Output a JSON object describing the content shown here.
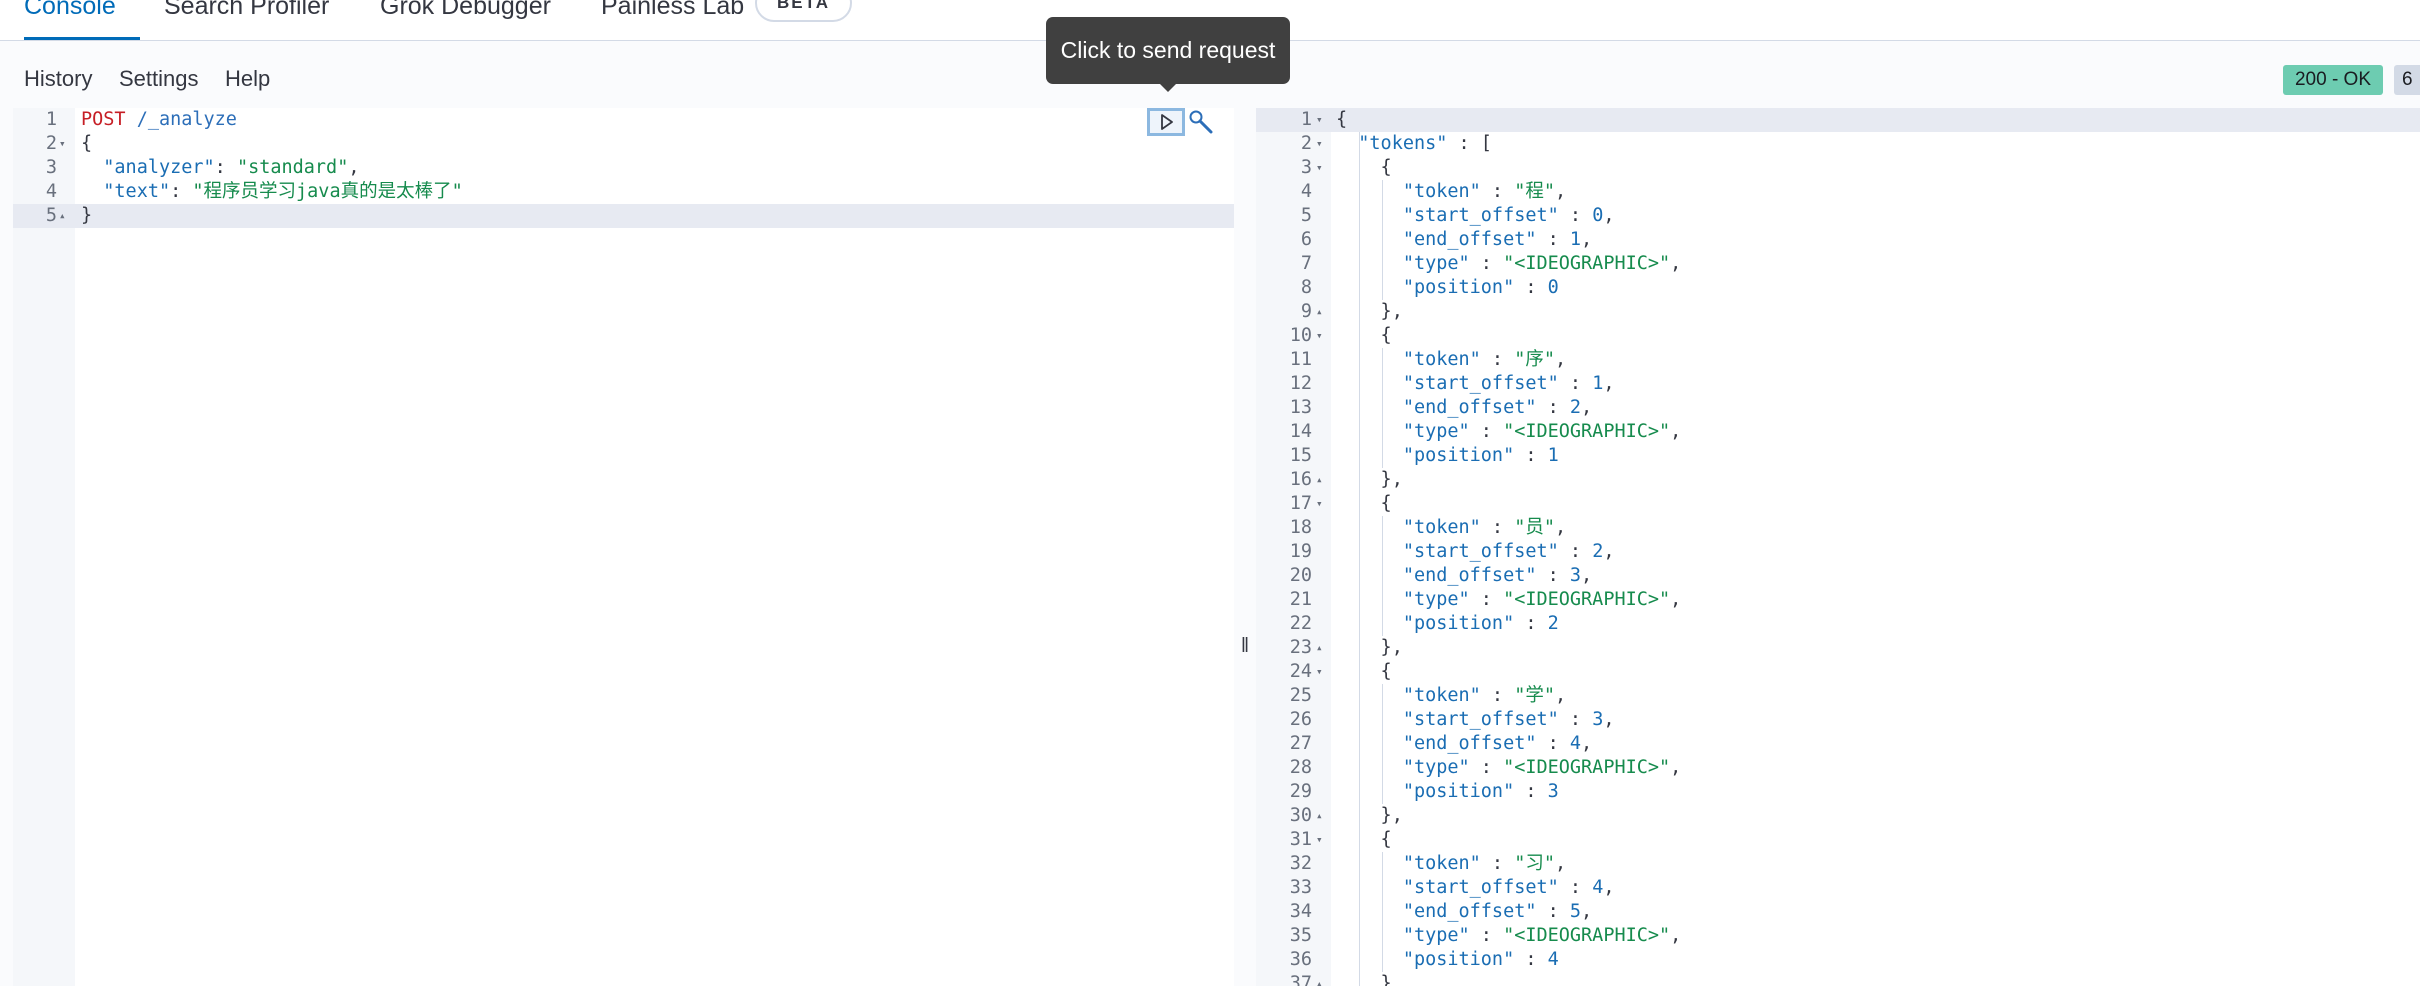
{
  "tabs": [
    {
      "label": "Console",
      "selected": true
    },
    {
      "label": "Search Profiler"
    },
    {
      "label": "Grok Debugger"
    },
    {
      "label": "Painless Lab",
      "badge": "BETA"
    }
  ],
  "menu": {
    "history": "History",
    "settings": "Settings",
    "help": "Help"
  },
  "status": {
    "code": "200 - OK",
    "time": "6"
  },
  "tooltip": "Click to send request",
  "request_lines": [
    {
      "n": "1",
      "parts": [
        [
          "method",
          "POST"
        ],
        [
          "punct",
          " "
        ],
        [
          "url",
          "/_analyze"
        ]
      ]
    },
    {
      "n": "2",
      "fold": "open",
      "parts": [
        [
          "punct",
          "{"
        ]
      ]
    },
    {
      "n": "3",
      "parts": [
        [
          "punct",
          "  "
        ],
        [
          "key",
          "\"analyzer\""
        ],
        [
          "punct",
          ": "
        ],
        [
          "str",
          "\"standard\""
        ],
        [
          "punct",
          ","
        ]
      ]
    },
    {
      "n": "4",
      "parts": [
        [
          "punct",
          "  "
        ],
        [
          "key",
          "\"text\""
        ],
        [
          "punct",
          ": "
        ],
        [
          "str",
          "\"程序员学习java真的是太棒了\""
        ]
      ]
    },
    {
      "n": "5",
      "fold": "close",
      "active": true,
      "parts": [
        [
          "punct",
          "}"
        ]
      ]
    }
  ],
  "response_lines": [
    {
      "n": "1",
      "fold": "open",
      "active": true,
      "parts": [
        [
          "punct",
          "{"
        ]
      ]
    },
    {
      "n": "2",
      "fold": "open",
      "parts": [
        [
          "punct",
          "  "
        ],
        [
          "key",
          "\"tokens\""
        ],
        [
          "punct",
          " : ["
        ]
      ]
    },
    {
      "n": "3",
      "fold": "open",
      "parts": [
        [
          "punct",
          "    {"
        ]
      ]
    },
    {
      "n": "4",
      "parts": [
        [
          "punct",
          "      "
        ],
        [
          "key",
          "\"token\""
        ],
        [
          "punct",
          " : "
        ],
        [
          "str",
          "\"程\""
        ],
        [
          "punct",
          ","
        ]
      ]
    },
    {
      "n": "5",
      "parts": [
        [
          "punct",
          "      "
        ],
        [
          "key",
          "\"start_offset\""
        ],
        [
          "punct",
          " : "
        ],
        [
          "num",
          "0"
        ],
        [
          "punct",
          ","
        ]
      ]
    },
    {
      "n": "6",
      "parts": [
        [
          "punct",
          "      "
        ],
        [
          "key",
          "\"end_offset\""
        ],
        [
          "punct",
          " : "
        ],
        [
          "num",
          "1"
        ],
        [
          "punct",
          ","
        ]
      ]
    },
    {
      "n": "7",
      "parts": [
        [
          "punct",
          "      "
        ],
        [
          "key",
          "\"type\""
        ],
        [
          "punct",
          " : "
        ],
        [
          "str",
          "\"<IDEOGRAPHIC>\""
        ],
        [
          "punct",
          ","
        ]
      ]
    },
    {
      "n": "8",
      "parts": [
        [
          "punct",
          "      "
        ],
        [
          "key",
          "\"position\""
        ],
        [
          "punct",
          " : "
        ],
        [
          "num",
          "0"
        ]
      ]
    },
    {
      "n": "9",
      "fold": "close",
      "parts": [
        [
          "punct",
          "    },"
        ]
      ]
    },
    {
      "n": "10",
      "fold": "open",
      "parts": [
        [
          "punct",
          "    {"
        ]
      ]
    },
    {
      "n": "11",
      "parts": [
        [
          "punct",
          "      "
        ],
        [
          "key",
          "\"token\""
        ],
        [
          "punct",
          " : "
        ],
        [
          "str",
          "\"序\""
        ],
        [
          "punct",
          ","
        ]
      ]
    },
    {
      "n": "12",
      "parts": [
        [
          "punct",
          "      "
        ],
        [
          "key",
          "\"start_offset\""
        ],
        [
          "punct",
          " : "
        ],
        [
          "num",
          "1"
        ],
        [
          "punct",
          ","
        ]
      ]
    },
    {
      "n": "13",
      "parts": [
        [
          "punct",
          "      "
        ],
        [
          "key",
          "\"end_offset\""
        ],
        [
          "punct",
          " : "
        ],
        [
          "num",
          "2"
        ],
        [
          "punct",
          ","
        ]
      ]
    },
    {
      "n": "14",
      "parts": [
        [
          "punct",
          "      "
        ],
        [
          "key",
          "\"type\""
        ],
        [
          "punct",
          " : "
        ],
        [
          "str",
          "\"<IDEOGRAPHIC>\""
        ],
        [
          "punct",
          ","
        ]
      ]
    },
    {
      "n": "15",
      "parts": [
        [
          "punct",
          "      "
        ],
        [
          "key",
          "\"position\""
        ],
        [
          "punct",
          " : "
        ],
        [
          "num",
          "1"
        ]
      ]
    },
    {
      "n": "16",
      "fold": "close",
      "parts": [
        [
          "punct",
          "    },"
        ]
      ]
    },
    {
      "n": "17",
      "fold": "open",
      "parts": [
        [
          "punct",
          "    {"
        ]
      ]
    },
    {
      "n": "18",
      "parts": [
        [
          "punct",
          "      "
        ],
        [
          "key",
          "\"token\""
        ],
        [
          "punct",
          " : "
        ],
        [
          "str",
          "\"员\""
        ],
        [
          "punct",
          ","
        ]
      ]
    },
    {
      "n": "19",
      "parts": [
        [
          "punct",
          "      "
        ],
        [
          "key",
          "\"start_offset\""
        ],
        [
          "punct",
          " : "
        ],
        [
          "num",
          "2"
        ],
        [
          "punct",
          ","
        ]
      ]
    },
    {
      "n": "20",
      "parts": [
        [
          "punct",
          "      "
        ],
        [
          "key",
          "\"end_offset\""
        ],
        [
          "punct",
          " : "
        ],
        [
          "num",
          "3"
        ],
        [
          "punct",
          ","
        ]
      ]
    },
    {
      "n": "21",
      "parts": [
        [
          "punct",
          "      "
        ],
        [
          "key",
          "\"type\""
        ],
        [
          "punct",
          " : "
        ],
        [
          "str",
          "\"<IDEOGRAPHIC>\""
        ],
        [
          "punct",
          ","
        ]
      ]
    },
    {
      "n": "22",
      "parts": [
        [
          "punct",
          "      "
        ],
        [
          "key",
          "\"position\""
        ],
        [
          "punct",
          " : "
        ],
        [
          "num",
          "2"
        ]
      ]
    },
    {
      "n": "23",
      "fold": "close",
      "parts": [
        [
          "punct",
          "    },"
        ]
      ]
    },
    {
      "n": "24",
      "fold": "open",
      "parts": [
        [
          "punct",
          "    {"
        ]
      ]
    },
    {
      "n": "25",
      "parts": [
        [
          "punct",
          "      "
        ],
        [
          "key",
          "\"token\""
        ],
        [
          "punct",
          " : "
        ],
        [
          "str",
          "\"学\""
        ],
        [
          "punct",
          ","
        ]
      ]
    },
    {
      "n": "26",
      "parts": [
        [
          "punct",
          "      "
        ],
        [
          "key",
          "\"start_offset\""
        ],
        [
          "punct",
          " : "
        ],
        [
          "num",
          "3"
        ],
        [
          "punct",
          ","
        ]
      ]
    },
    {
      "n": "27",
      "parts": [
        [
          "punct",
          "      "
        ],
        [
          "key",
          "\"end_offset\""
        ],
        [
          "punct",
          " : "
        ],
        [
          "num",
          "4"
        ],
        [
          "punct",
          ","
        ]
      ]
    },
    {
      "n": "28",
      "parts": [
        [
          "punct",
          "      "
        ],
        [
          "key",
          "\"type\""
        ],
        [
          "punct",
          " : "
        ],
        [
          "str",
          "\"<IDEOGRAPHIC>\""
        ],
        [
          "punct",
          ","
        ]
      ]
    },
    {
      "n": "29",
      "parts": [
        [
          "punct",
          "      "
        ],
        [
          "key",
          "\"position\""
        ],
        [
          "punct",
          " : "
        ],
        [
          "num",
          "3"
        ]
      ]
    },
    {
      "n": "30",
      "fold": "close",
      "parts": [
        [
          "punct",
          "    },"
        ]
      ]
    },
    {
      "n": "31",
      "fold": "open",
      "parts": [
        [
          "punct",
          "    {"
        ]
      ]
    },
    {
      "n": "32",
      "parts": [
        [
          "punct",
          "      "
        ],
        [
          "key",
          "\"token\""
        ],
        [
          "punct",
          " : "
        ],
        [
          "str",
          "\"习\""
        ],
        [
          "punct",
          ","
        ]
      ]
    },
    {
      "n": "33",
      "parts": [
        [
          "punct",
          "      "
        ],
        [
          "key",
          "\"start_offset\""
        ],
        [
          "punct",
          " : "
        ],
        [
          "num",
          "4"
        ],
        [
          "punct",
          ","
        ]
      ]
    },
    {
      "n": "34",
      "parts": [
        [
          "punct",
          "      "
        ],
        [
          "key",
          "\"end_offset\""
        ],
        [
          "punct",
          " : "
        ],
        [
          "num",
          "5"
        ],
        [
          "punct",
          ","
        ]
      ]
    },
    {
      "n": "35",
      "parts": [
        [
          "punct",
          "      "
        ],
        [
          "key",
          "\"type\""
        ],
        [
          "punct",
          " : "
        ],
        [
          "str",
          "\"<IDEOGRAPHIC>\""
        ],
        [
          "punct",
          ","
        ]
      ]
    },
    {
      "n": "36",
      "parts": [
        [
          "punct",
          "      "
        ],
        [
          "key",
          "\"position\""
        ],
        [
          "punct",
          " : "
        ],
        [
          "num",
          "4"
        ]
      ]
    },
    {
      "n": "37",
      "fold": "close",
      "parts": [
        [
          "punct",
          "    },"
        ]
      ]
    }
  ],
  "colors": {
    "accent": "#006bb8",
    "success_badge": "#6dccb1",
    "tooltip_bg": "#404040"
  },
  "icons": {
    "send": "play-icon",
    "settings": "wrench-icon",
    "resize": "resize-handle-icon"
  }
}
